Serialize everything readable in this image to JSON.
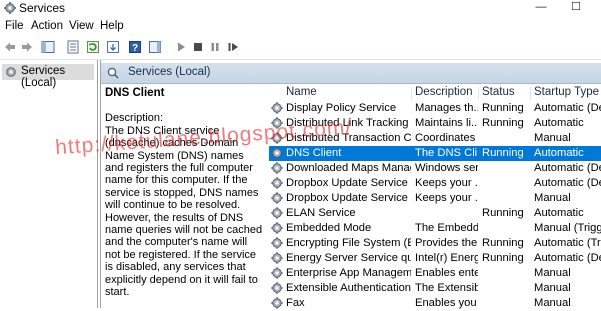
{
  "window": {
    "title": "Services",
    "minimize_glyph": "—",
    "maximize_glyph": "☐"
  },
  "menu": [
    "File",
    "Action",
    "View",
    "Help"
  ],
  "tree": {
    "label": "Services (Local)"
  },
  "panel": {
    "title": "Services (Local)"
  },
  "description": {
    "service_name": "DNS Client",
    "label": "Description:",
    "text": "The DNS Client service (dnscache) caches Domain Name System (DNS) names and registers the full computer name for this computer. If the service is stopped, DNS names will continue to be resolved. However, the results of DNS name queries will not be cached and the computer's name will not be registered. If the service is disabled, any services that explicitly depend on it will fail to start."
  },
  "table": {
    "columns": [
      "Name",
      "Description",
      "Status",
      "Startup Type"
    ],
    "rows": [
      {
        "name": "Display Policy Service",
        "description": "Manages th...",
        "status": "Running",
        "startup": "Automatic (De"
      },
      {
        "name": "Distributed Link Tracking Cl...",
        "description": "Maintains li...",
        "status": "Running",
        "startup": "Automatic"
      },
      {
        "name": "Distributed Transaction Coor...",
        "description": "Coordinates ...",
        "status": "",
        "startup": "Manual"
      },
      {
        "name": "DNS Client",
        "description": "The DNS Cli...",
        "status": "Running",
        "startup": "Automatic",
        "selected": true
      },
      {
        "name": "Downloaded Maps Manager",
        "description": "Windows ser...",
        "status": "",
        "startup": "Automatic (De"
      },
      {
        "name": "Dropbox Update Service (db...",
        "description": "Keeps your ...",
        "status": "",
        "startup": "Automatic (De"
      },
      {
        "name": "Dropbox Update Service (db...",
        "description": "Keeps your ...",
        "status": "",
        "startup": "Manual"
      },
      {
        "name": "ELAN Service",
        "description": "",
        "status": "Running",
        "startup": "Automatic"
      },
      {
        "name": "Embedded Mode",
        "description": "The Embedd...",
        "status": "",
        "startup": "Manual (Trigg"
      },
      {
        "name": "Encrypting File System (EFS)",
        "description": "Provides the...",
        "status": "Running",
        "startup": "Automatic (Trig"
      },
      {
        "name": "Energy Server Service queen...",
        "description": "Intel(r) Energ...",
        "status": "Running",
        "startup": "Automatic (De"
      },
      {
        "name": "Enterprise App Managemen...",
        "description": "Enables ente...",
        "status": "",
        "startup": "Manual"
      },
      {
        "name": "Extensible Authentication Pr...",
        "description": "The Extensib...",
        "status": "",
        "startup": "Manual"
      },
      {
        "name": "Fax",
        "description": "Enables you ...",
        "status": "",
        "startup": "Manual"
      }
    ]
  },
  "watermark": "http://ketulane.blogspot.com/",
  "colors": {
    "selection": "#0078d7",
    "panel_header": "#c6d4e4",
    "watermark": "#e11e1e"
  }
}
